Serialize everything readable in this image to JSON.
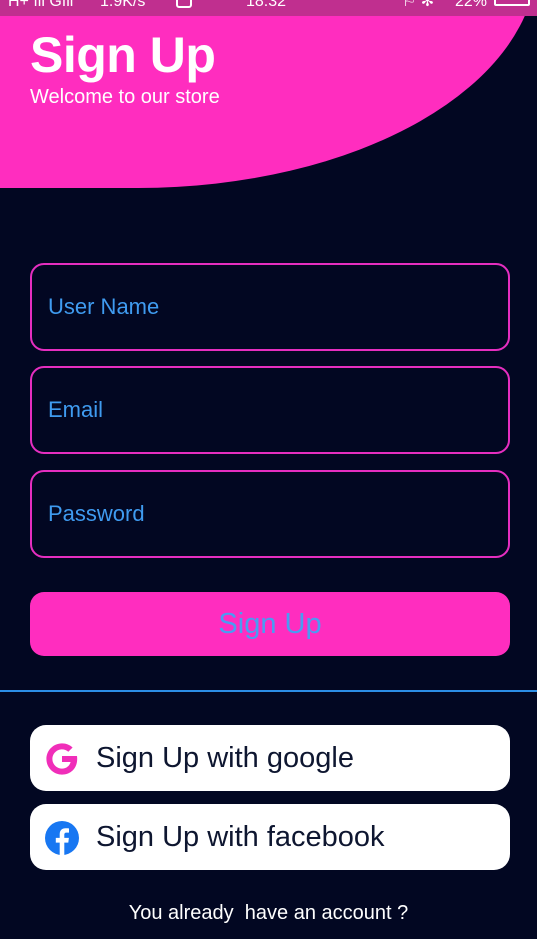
{
  "status_bar": {
    "signal": "H+ ıll  Gıll",
    "speed": "1.9K/s",
    "time": "18:32",
    "icons": "⚐ ✻",
    "battery": "22%"
  },
  "header": {
    "title": "Sign Up",
    "subtitle": "Welcome to our store"
  },
  "form": {
    "username_placeholder": "User Name",
    "email_placeholder": "Email",
    "password_placeholder": "Password",
    "submit_label": "Sign Up"
  },
  "social": {
    "google_label": "Sign Up with google",
    "facebook_label": "Sign Up with facebook"
  },
  "footer": {
    "text": "You already  have an account ?"
  },
  "colors": {
    "background": "#020722",
    "accent": "#ff2dbf",
    "placeholder": "#3f9bf0",
    "divider": "#2c8ee6"
  }
}
